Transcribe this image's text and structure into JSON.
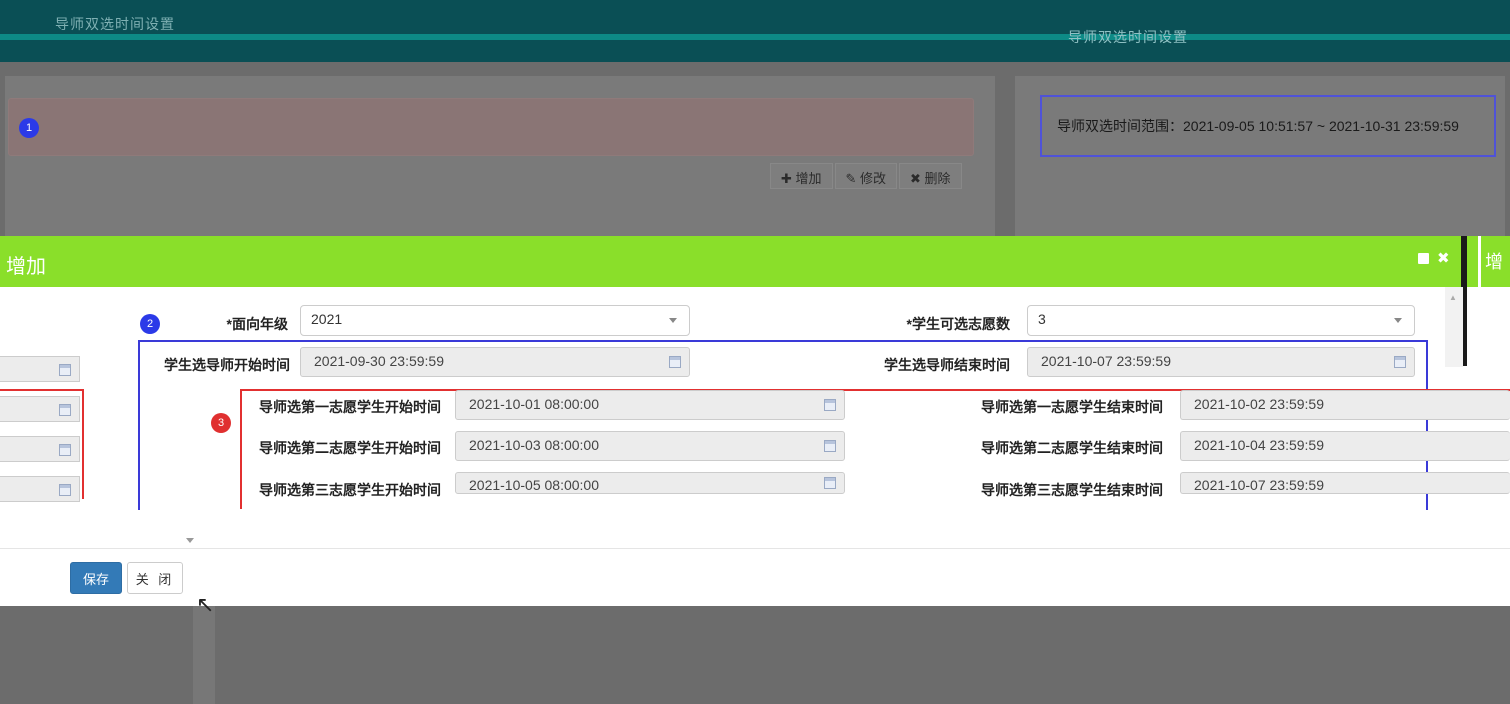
{
  "background": {
    "top_title": "导师双选时间设置",
    "right_title": "导师双选时间设置",
    "time_range": "导师双选时间范围：2021-09-05 10:51:57 ~ 2021-10-31 23:59:59",
    "toolbar": {
      "add": "✚ 增加",
      "edit": "✎ 修改",
      "delete": "✖ 删除"
    }
  },
  "badges": {
    "one": "1",
    "two": "2",
    "three": "3"
  },
  "modal": {
    "title": "增加",
    "side_tab": "增",
    "form": {
      "grade_label": "*面向年级",
      "grade_value": "2021",
      "choices_label": "*学生可选志愿数",
      "choices_value": "3",
      "student_start_label": "学生选导师开始时间",
      "student_start_value": "2021-09-30 23:59:59",
      "student_end_label": "学生选导师结束时间",
      "student_end_value": "2021-10-07 23:59:59",
      "rounds": [
        {
          "start_label": "导师选第一志愿学生开始时间",
          "start_value": "2021-10-01 08:00:00",
          "end_label": "导师选第一志愿学生结束时间",
          "end_value": "2021-10-02 23:59:59"
        },
        {
          "start_label": "导师选第二志愿学生开始时间",
          "start_value": "2021-10-03 08:00:00",
          "end_label": "导师选第二志愿学生结束时间",
          "end_value": "2021-10-04 23:59:59"
        },
        {
          "start_label": "导师选第三志愿学生开始时间",
          "start_value": "2021-10-05 08:00:00",
          "end_label": "导师选第三志愿学生结束时间",
          "end_value": "2021-10-07 23:59:59"
        }
      ]
    },
    "buttons": {
      "save": "保存",
      "close": "关 闭"
    }
  }
}
